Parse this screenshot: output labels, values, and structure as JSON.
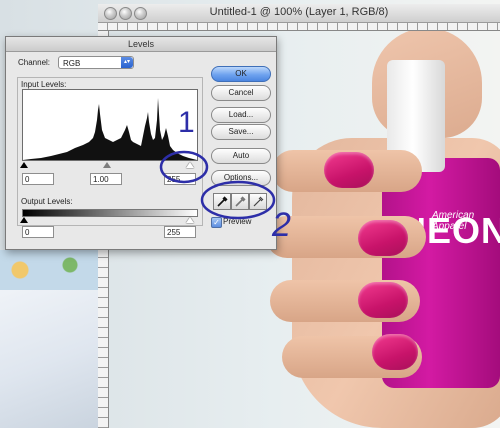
{
  "document": {
    "title": "Untitled-1 @ 100% (Layer 1, RGB/8)"
  },
  "photo": {
    "brand": "American Apparel",
    "product": "NEON"
  },
  "levels_dialog": {
    "title": "Levels",
    "channel_label": "Channel:",
    "channel_value": "RGB",
    "input_levels_label": "Input Levels:",
    "input_black": "0",
    "input_gamma": "1.00",
    "input_white": "255",
    "output_levels_label": "Output Levels:",
    "output_black": "0",
    "output_white": "255",
    "buttons": {
      "ok": "OK",
      "cancel": "Cancel",
      "load": "Load...",
      "save": "Save...",
      "auto": "Auto",
      "options": "Options..."
    },
    "preview_label": "Preview",
    "preview_checked": true,
    "accent": "#4c86e0"
  },
  "annotations": {
    "mark_1": "1",
    "mark_2": "2",
    "color": "#2d2ea8"
  }
}
